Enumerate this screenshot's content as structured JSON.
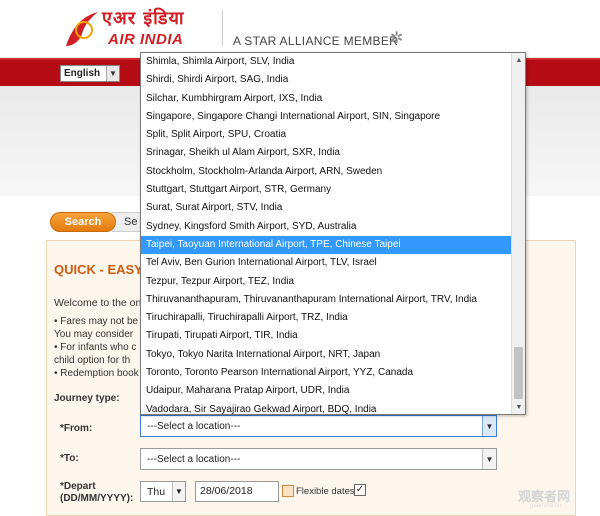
{
  "header": {
    "logo_hindi": "एअर इंडिया",
    "logo_text": "AIR INDIA",
    "alliance_text": "A STAR ALLIANCE MEMBER",
    "alliance_icon": "star-alliance-icon"
  },
  "language": {
    "value": "English"
  },
  "steps": {
    "search": "Search",
    "next_partial": "Se"
  },
  "form": {
    "title": "QUICK - EASY",
    "welcome": "Welcome to the onl",
    "bullets": [
      "• Fares may not be",
      "  You may consider",
      "• For infants who c",
      "  child option for th",
      "• Redemption book"
    ],
    "journey_type_label": "Journey type:",
    "from_label": "*From:",
    "from_value": "---Select a location---",
    "to_label": "*To:",
    "to_value": "---Select a location---",
    "depart_label": "*Depart",
    "depart_format": "(DD/MM/YYYY):",
    "day_value": "Thu",
    "date_value": "28/06/2018",
    "flexible_label": "Flexible dates:",
    "flexible_checked": "✓"
  },
  "dropdown": {
    "items": [
      "Shimla, Shimla Airport, SLV, India",
      "Shirdi, Shirdi Airport, SAG, India",
      "Silchar, Kumbhirgram Airport, IXS, India",
      "Singapore, Singapore Changi International Airport, SIN, Singapore",
      "Split, Split Airport, SPU, Croatia",
      "Srinagar, Sheikh ul Alam Airport, SXR, India",
      "Stockholm, Stockholm-Arlanda Airport, ARN, Sweden",
      "Stuttgart, Stuttgart Airport, STR, Germany",
      "Surat, Surat Airport, STV, India",
      "Sydney, Kingsford Smith Airport, SYD, Australia",
      "Taipei, Taoyuan International Airport, TPE, Chinese Taipei",
      "Tel Aviv, Ben Gurion International Airport, TLV, Israel",
      "Tezpur, Tezpur Airport, TEZ, India",
      "Thiruvananthapuram, Thiruvananthapuram International Airport, TRV, India",
      "Tiruchirapalli, Tiruchirapalli Airport, TRZ, India",
      "Tirupati, Tirupati Airport, TIR, India",
      "Tokyo, Tokyo Narita International Airport, NRT, Japan",
      "Toronto, Toronto Pearson International Airport, YYZ, Canada",
      "Udaipur, Maharana Pratap Airport, UDR, India",
      "Vadodara, Sir Sayajirao Gekwad Airport, BDQ, India"
    ],
    "selected_index": 10
  },
  "watermark": {
    "main": "观察者网",
    "sub": "guancha.cn"
  },
  "colors": {
    "brand_red": "#b50c16",
    "accent_orange": "#e57c10",
    "selection_blue": "#3399ff"
  }
}
